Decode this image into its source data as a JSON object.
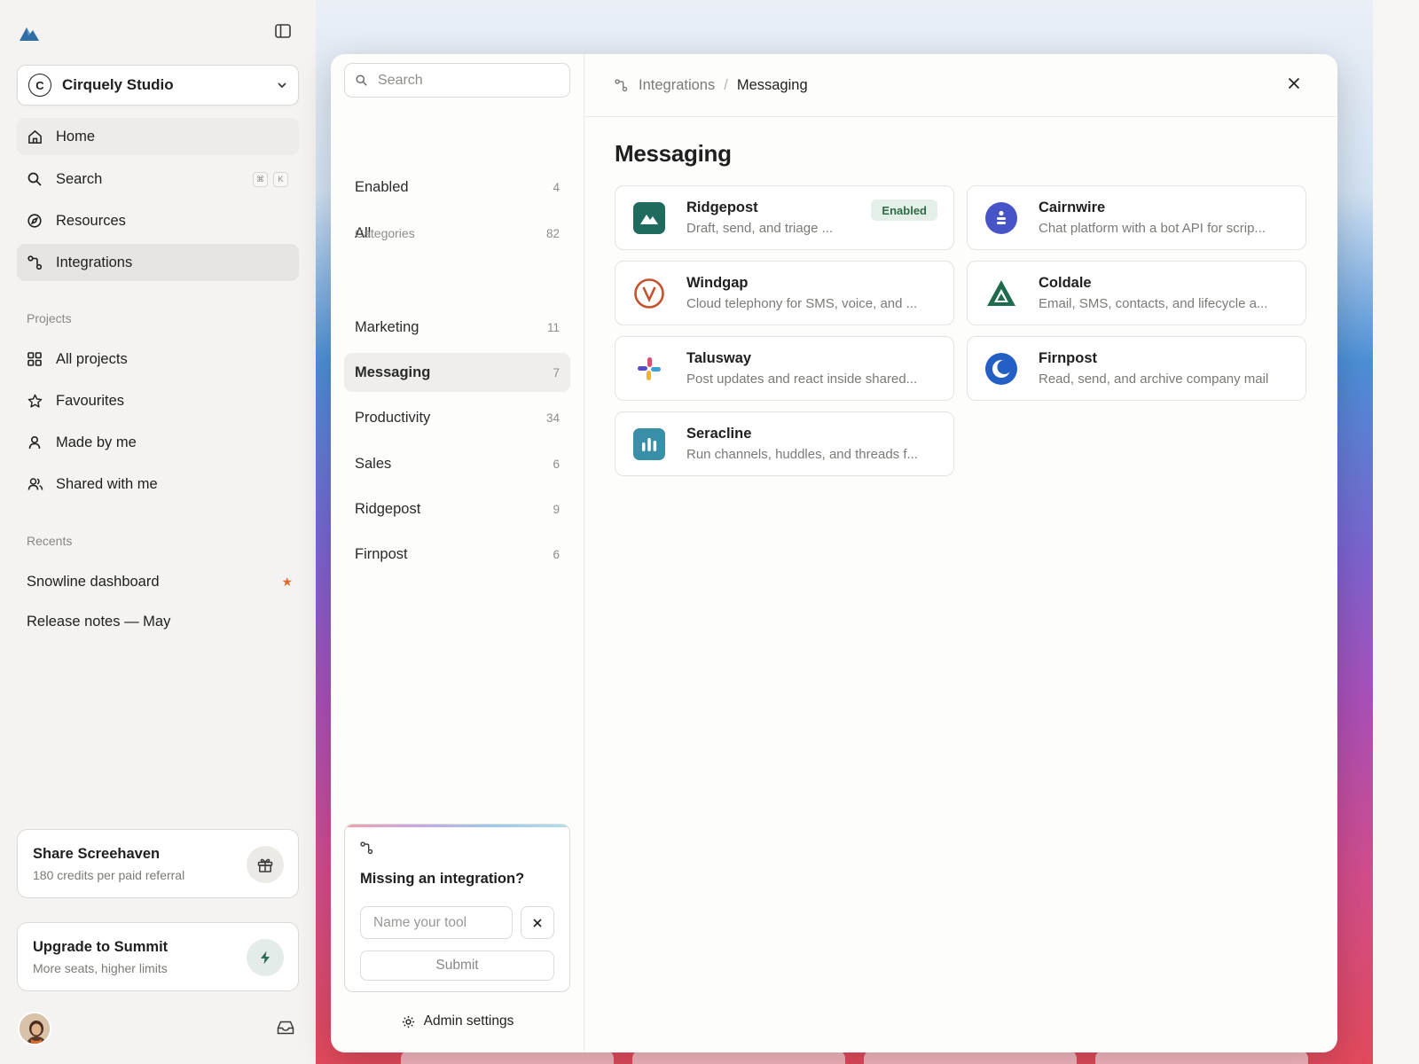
{
  "sidebar": {
    "org_name": "Cirquely Studio",
    "org_initial": "C",
    "nav": [
      {
        "label": "Home",
        "icon": "home-icon"
      },
      {
        "label": "Search",
        "icon": "search-icon",
        "shortcut": [
          "⌘",
          "K"
        ]
      },
      {
        "label": "Resources",
        "icon": "compass-icon"
      },
      {
        "label": "Integrations",
        "icon": "integrations-icon"
      }
    ],
    "projects_label": "Projects",
    "projects": [
      {
        "label": "All projects",
        "icon": "grid-icon"
      },
      {
        "label": "Favourites",
        "icon": "star-icon"
      },
      {
        "label": "Made by me",
        "icon": "user-icon"
      },
      {
        "label": "Shared with me",
        "icon": "users-icon"
      }
    ],
    "recents_label": "Recents",
    "recents": [
      {
        "label": "Snowline dashboard",
        "starred": true,
        "star": "★"
      },
      {
        "label": "Release notes — May",
        "starred": false
      }
    ],
    "share_card": {
      "title": "Share Screehaven",
      "subtitle": "180 credits per paid referral",
      "icon": "gift-icon"
    },
    "upgrade_card": {
      "title": "Upgrade to Summit",
      "subtitle": "More seats, higher limits",
      "icon": "bolt-icon"
    }
  },
  "modal": {
    "search_placeholder": "Search",
    "filters": [
      {
        "label": "Enabled",
        "count": "4"
      },
      {
        "label": "All",
        "count": "82"
      }
    ],
    "categories_label": "Categories",
    "categories": [
      {
        "label": "Marketing",
        "count": "11"
      },
      {
        "label": "Messaging",
        "count": "7",
        "active": true
      },
      {
        "label": "Productivity",
        "count": "34"
      },
      {
        "label": "Sales",
        "count": "6"
      },
      {
        "label": "Ridgepost",
        "count": "9"
      },
      {
        "label": "Firnpost",
        "count": "6"
      }
    ],
    "missing": {
      "title": "Missing an integration?",
      "input_placeholder": "Name your tool",
      "submit_label": "Submit"
    },
    "admin_label": "Admin settings",
    "breadcrumb": {
      "parent": "Integrations",
      "separator": "/",
      "current": "Messaging"
    },
    "page_title": "Messaging",
    "integrations": [
      {
        "name": "Ridgepost",
        "description": "Draft, send, and triage ...",
        "badge": "Enabled",
        "color": "#1f6b5e",
        "icon": "mountain-logo"
      },
      {
        "name": "Cairnwire",
        "description": "Chat platform with a bot API for scrip...",
        "color": "#4754c8",
        "icon": "person-circle-logo"
      },
      {
        "name": "Windgap",
        "description": "Cloud telephony for SMS, voice, and ...",
        "color": "#c4522e",
        "icon": "v-circle-logo"
      },
      {
        "name": "Coldale",
        "description": "Email, SMS, contacts, and lifecycle a...",
        "color": "#1f6b4e",
        "icon": "triangle-logo"
      },
      {
        "name": "Talusway",
        "description": "Post updates and react inside shared...",
        "color": "#e24a6b",
        "icon": "pinwheel-logo"
      },
      {
        "name": "Firnpost",
        "description": "Read, send, and archive company mail",
        "color": "#2460c4",
        "icon": "crescent-logo"
      },
      {
        "name": "Seracline",
        "description": "Run channels, huddles, and threads f...",
        "color": "#3a8fa8",
        "icon": "bars-logo"
      }
    ]
  },
  "colors": {
    "accent_enabled_bg": "#e4efe8",
    "accent_enabled_text": "#2e6a48",
    "recent_star": "#e26b2b"
  }
}
